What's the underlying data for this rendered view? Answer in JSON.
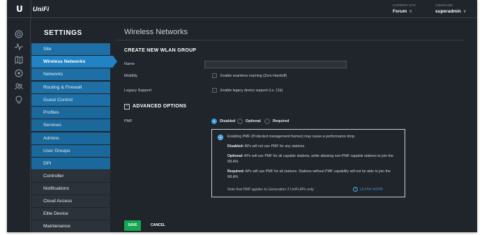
{
  "colors": {
    "background": "#20252b",
    "nav_blue": "#1d6fa5",
    "nav_active": "#2283c4",
    "nav_dark": "#2c3239",
    "accent": "#2f9be4",
    "save_green": "#15a650"
  },
  "header": {
    "logo_glyph": "U",
    "brand": "UniFi",
    "site_caption": "CURRENT SITE",
    "site_value": "Forum",
    "user_caption": "USERNAME",
    "user_value": "superadmin",
    "chevron": "∨"
  },
  "rail": {
    "icons": [
      "dashboard-icon",
      "statistics-icon",
      "map-icon",
      "devices-icon",
      "clients-icon",
      "insights-icon"
    ]
  },
  "sidebar": {
    "title": "SETTINGS",
    "items": [
      {
        "label": "Site"
      },
      {
        "label": "Wireless Networks"
      },
      {
        "label": "Networks"
      },
      {
        "label": "Routing & Firewall"
      },
      {
        "label": "Guest Control"
      },
      {
        "label": "Profiles"
      },
      {
        "label": "Services"
      },
      {
        "label": "Admins"
      },
      {
        "label": "User Groups"
      },
      {
        "label": "DPI"
      },
      {
        "label": "Controller"
      },
      {
        "label": "Notifications"
      },
      {
        "label": "Cloud Access"
      },
      {
        "label": "Elite Device"
      },
      {
        "label": "Maintenance"
      }
    ],
    "active": "Wireless Networks"
  },
  "main": {
    "page_title": "Wireless Networks",
    "section_title": "CREATE NEW WLAN GROUP",
    "name_label": "Name",
    "name_value": "",
    "mobility_label": "Mobility",
    "mobility_option": "Enable seamless roaming (Zero-Handoff)",
    "legacy_label": "Legacy Support",
    "legacy_option": "Enable legacy device support (i.e. 11b)",
    "advanced_toggle": "−",
    "advanced_title": "ADVANCED OPTIONS",
    "pmf_label": "PMF",
    "pmf_options": [
      "Disabled",
      "Optional",
      "Required"
    ],
    "pmf_selected": "Disabled",
    "info": {
      "intro": "Enabling PMF (Protected management frames) may cause a performance drop.",
      "disabled_term": "Disabled:",
      "disabled_text": "APs will not use PMF for any stations.",
      "optional_term": "Optional:",
      "optional_text": "APs will use PMF for all capable stations, while allowing non-PMF capable stations to join the WLAN.",
      "required_term": "Required:",
      "required_text": "APs will use PMF for all stations. Stations without PMF capability will not be able to join the WLAN.",
      "note": "Note that PMF applies to Generation 3 UniFi APs only.",
      "learn_more": "LEARN MORE",
      "learn_glyph": "i"
    },
    "save_label": "SAVE",
    "cancel_label": "CANCEL"
  }
}
